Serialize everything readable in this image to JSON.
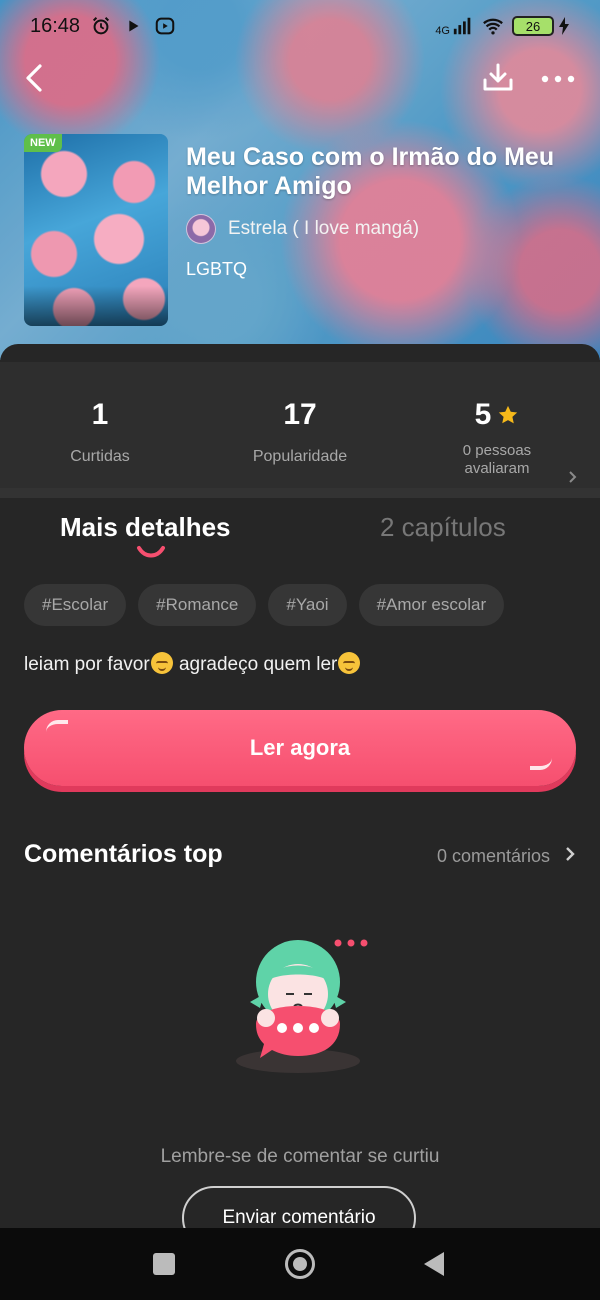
{
  "status_bar": {
    "time": "16:48",
    "network": "4G",
    "battery": "26"
  },
  "book": {
    "badge": "NEW",
    "title": "Meu Caso com o Irmão do Meu Melhor Amigo",
    "author": "Estrela ( I love mangá)",
    "genre": "LGBTQ"
  },
  "stats": {
    "likes_value": "1",
    "likes_label": "Curtidas",
    "popularity_value": "17",
    "popularity_label": "Popularidade",
    "rating_value": "5",
    "rating_label_line1": "0 pessoas",
    "rating_label_line2": "avaliaram"
  },
  "tabs": {
    "details": "Mais detalhes",
    "chapters": "2 capítulos"
  },
  "tags": [
    "#Escolar",
    "#Romance",
    "#Yaoi",
    "#Amor escolar"
  ],
  "description": {
    "part1": "leiam por favor",
    "part2": " agradeço quem ler"
  },
  "read_button": "Ler agora",
  "comments": {
    "title": "Comentários top",
    "count": "0 comentários",
    "empty_text": "Lembre-se de comentar se curtiu",
    "send_button": "Enviar comentário"
  },
  "colors": {
    "accent": "#f64f6f",
    "panel_bg": "#262626",
    "star": "#f6b91a"
  }
}
